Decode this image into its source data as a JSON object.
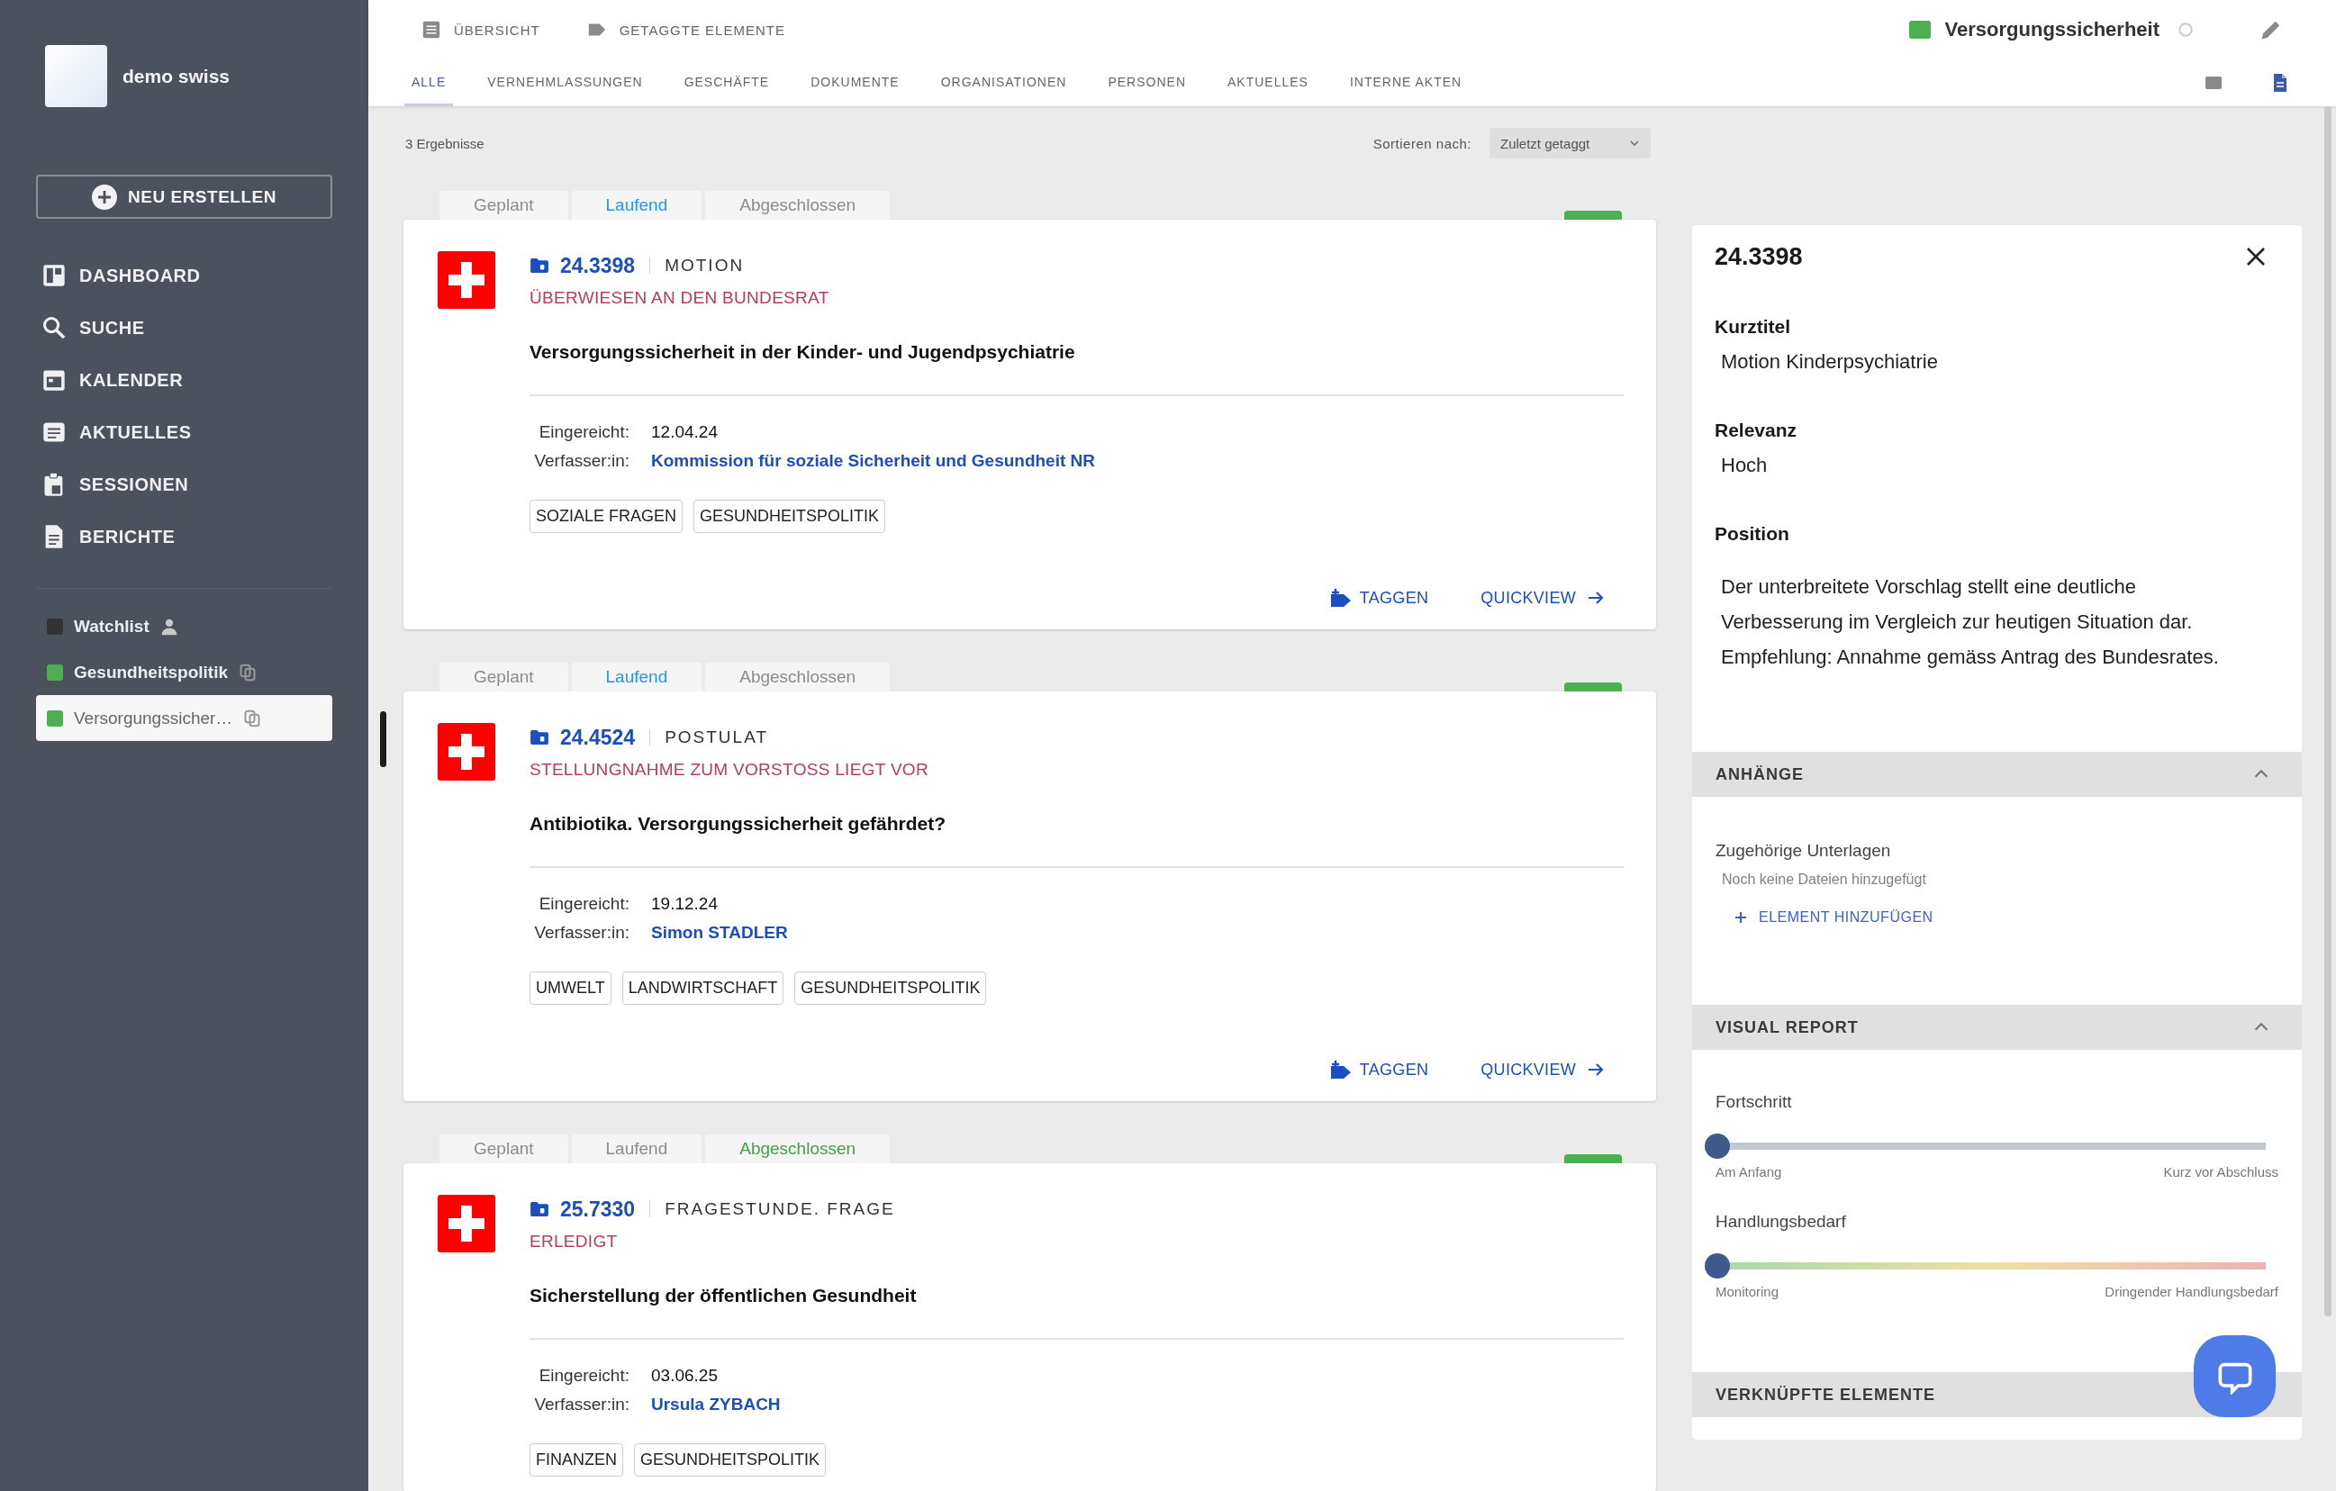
{
  "sidebar": {
    "user": {
      "name": "demo swiss"
    },
    "create_button": {
      "label": "NEU ERSTELLEN"
    },
    "nav_items": [
      {
        "label": "DASHBOARD",
        "kind": "dashboard"
      },
      {
        "label": "SUCHE",
        "kind": "search"
      },
      {
        "label": "KALENDER",
        "kind": "calendar"
      },
      {
        "label": "AKTUELLES",
        "kind": "news"
      },
      {
        "label": "SESSIONEN",
        "kind": "sessions"
      },
      {
        "label": "BERICHTE",
        "kind": "reports"
      }
    ],
    "lists": [
      {
        "label": "Watchlist",
        "kind": "watchlist",
        "color": "#333333",
        "selected": false
      },
      {
        "label": "Gesundheitspolitik",
        "kind": "list",
        "color": "#4caf50",
        "selected": false
      },
      {
        "label": "Versorgungssicher…",
        "kind": "list",
        "color": "#4caf50",
        "selected": true
      }
    ]
  },
  "topbar": {
    "nav": [
      {
        "label": "ÜBERSICHT",
        "kind": "overview"
      },
      {
        "label": "GETAGGTE ELEMENTE",
        "kind": "tagged"
      }
    ],
    "list_title": "Versorgungssicherheit",
    "tabs": [
      {
        "label": "ALLE",
        "selected": true
      },
      {
        "label": "VERNEHMLASSUNGEN",
        "selected": false
      },
      {
        "label": "GESCHÄFTE",
        "selected": false
      },
      {
        "label": "DOKUMENTE",
        "selected": false
      },
      {
        "label": "ORGANISATIONEN",
        "selected": false
      },
      {
        "label": "PERSONEN",
        "selected": false
      },
      {
        "label": "AKTUELLES",
        "selected": false
      },
      {
        "label": "INTERNE AKTEN",
        "selected": false
      }
    ]
  },
  "toolbar": {
    "result_count": "3 Ergebnisse",
    "sort_label": "Sortieren nach:",
    "sort_value": "Zuletzt getaggt"
  },
  "cards": [
    {
      "phase_tabs": [
        {
          "label": "Geplant",
          "kind": "planned",
          "selected": false
        },
        {
          "label": "Laufend",
          "kind": "running",
          "selected": true
        },
        {
          "label": "Abgeschlossen",
          "kind": "done",
          "selected": false
        }
      ],
      "number": "24.3398",
      "type": "MOTION",
      "status": "ÜBERWIESEN AN DEN BUNDESRAT",
      "title": "Versorgungssicherheit in der Kinder- und Jugendpsychiatrie",
      "fields": [
        {
          "label": "Eingereicht:",
          "value": "12.04.24",
          "kind": "date"
        },
        {
          "label": "Verfasser:in:",
          "value": "Kommission für soziale Sicherheit und Gesundheit NR",
          "kind": "link"
        }
      ],
      "tags": [
        "SOZIALE FRAGEN",
        "GESUNDHEITSPOLITIK"
      ],
      "actions": [
        {
          "label": "TAGGEN",
          "kind": "tag"
        },
        {
          "label": "QUICKVIEW",
          "kind": "open"
        }
      ]
    },
    {
      "phase_tabs": [
        {
          "label": "Geplant",
          "kind": "planned",
          "selected": false
        },
        {
          "label": "Laufend",
          "kind": "running",
          "selected": true
        },
        {
          "label": "Abgeschlossen",
          "kind": "done",
          "selected": false
        }
      ],
      "number": "24.4524",
      "type": "POSTULAT",
      "status": "STELLUNGNAHME ZUM VORSTOSS LIEGT VOR",
      "title": "Antibiotika. Versorgungssicherheit gefährdet?",
      "fields": [
        {
          "label": "Eingereicht:",
          "value": "19.12.24",
          "kind": "date"
        },
        {
          "label": "Verfasser:in:",
          "value": "Simon STADLER",
          "kind": "link"
        }
      ],
      "tags": [
        "UMWELT",
        "LANDWIRTSCHAFT",
        "GESUNDHEITSPOLITIK"
      ],
      "actions": [
        {
          "label": "TAGGEN",
          "kind": "tag"
        },
        {
          "label": "QUICKVIEW",
          "kind": "open"
        }
      ]
    },
    {
      "phase_tabs": [
        {
          "label": "Geplant",
          "kind": "planned",
          "selected": false
        },
        {
          "label": "Laufend",
          "kind": "running",
          "selected": false
        },
        {
          "label": "Abgeschlossen",
          "kind": "done",
          "selected": true
        }
      ],
      "number": "25.7330",
      "type": "FRAGESTUNDE. FRAGE",
      "status": "ERLEDIGT",
      "title": "Sicherstellung der öffentlichen Gesundheit",
      "fields": [
        {
          "label": "Eingereicht:",
          "value": "03.06.25",
          "kind": "date"
        },
        {
          "label": "Verfasser:in:",
          "value": "Ursula ZYBACH",
          "kind": "link"
        }
      ],
      "tags": [
        "FINANZEN",
        "GESUNDHEITSPOLITIK"
      ]
    }
  ],
  "detail_panel": {
    "title": "24.3398",
    "fields": [
      {
        "label": "Kurztitel",
        "value": "Motion Kinderpsychiatrie",
        "kind": "line"
      },
      {
        "label": "Relevanz",
        "value": "Hoch",
        "kind": "line"
      },
      {
        "label": "Position",
        "value": "Der unterbreitete Vorschlag stellt eine deutliche Verbesserung im Vergleich zur heutigen Situation dar. Empfehlung: Annahme gemäss Antrag des Bundesrates.",
        "kind": "paragraph"
      }
    ],
    "sections": [
      {
        "title": "ANHÄNGE",
        "kind": "attachments",
        "expanded": true,
        "heading": "Zugehörige Unterlagen",
        "empty_text": "Noch keine Dateien hinzugefügt",
        "add_label": "ELEMENT HINZUFÜGEN"
      },
      {
        "title": "VISUAL REPORT",
        "kind": "report",
        "expanded": true,
        "sliders": [
          {
            "label": "Fortschritt",
            "kind": "progress",
            "level": 0,
            "min_label": "Am Anfang",
            "max_label": "Kurz vor Abschluss"
          },
          {
            "label": "Handlungsbedarf",
            "kind": "urgency",
            "level": 0,
            "min_label": "Monitoring",
            "max_label": "Dringender Handlungsbedarf"
          }
        ]
      },
      {
        "title": "VERKNÜPFTE ELEMENTE"
      }
    ]
  }
}
